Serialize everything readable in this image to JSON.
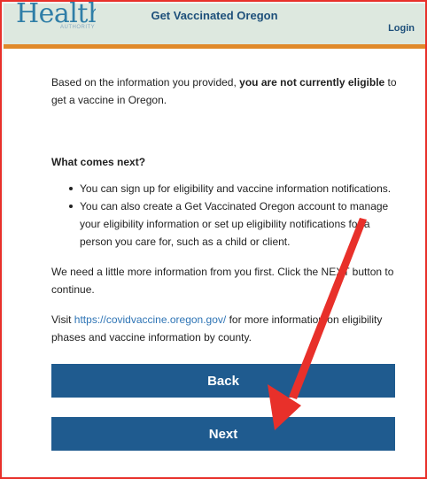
{
  "header": {
    "logo_text": "Health",
    "logo_sub": "AUTHORITY",
    "title": "Get Vaccinated Oregon",
    "login_label": "Login"
  },
  "main": {
    "result_prefix": "Based on the information you provided,",
    "result_bold": "you are not currently eligible",
    "result_suffix": "to get a vaccine in Oregon.",
    "next_heading": "What comes next?",
    "bullets": [
      "You can sign up for eligibility and vaccine information notifications.",
      "You can also create a Get Vaccinated Oregon account to manage your eligibility information or set up eligibility notifications for a person you care for, such as a child or client."
    ],
    "more_info": "We need a little more information from you first. Click the NEXT button to continue.",
    "visit_prefix": "Visit",
    "visit_link": "https://covidvaccine.oregon.gov/",
    "visit_suffix": "for more information on eligibility phases and vaccine information by county."
  },
  "buttons": {
    "back_label": "Back",
    "next_label": "Next"
  },
  "colors": {
    "brand_blue": "#1f5b8f",
    "header_bg": "#dde8df",
    "header_stripe": "#e0892a",
    "annotation_red": "#e8302a",
    "link": "#2e74b5"
  }
}
